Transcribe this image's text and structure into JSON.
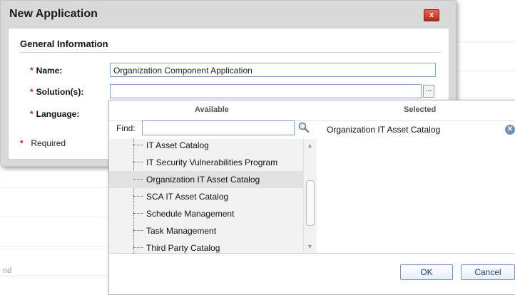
{
  "dialog": {
    "title": "New Application",
    "close_label": "x",
    "section_title": "General Information",
    "fields": {
      "name_label": "Name:",
      "name_value": "Organization Component Application",
      "solutions_label": "Solution(s):",
      "solutions_value": "",
      "solutions_button": "...",
      "language_label": "Language:"
    },
    "required_star": "*",
    "required_text": "Required"
  },
  "picker": {
    "available_header": "Available",
    "selected_header": "Selected",
    "find_label": "Find:",
    "find_value": "",
    "available_items": [
      "IT Asset Catalog",
      "IT Security Vulnerabilities Program",
      "Organization IT Asset Catalog",
      "SCA IT Asset Catalog",
      "Schedule Management",
      "Task Management",
      "Third Party Catalog"
    ],
    "highlighted_item": "Organization IT Asset Catalog",
    "selected_items": [
      "Organization IT Asset Catalog"
    ],
    "ok_label": "OK",
    "cancel_label": "Cancel",
    "icons": {
      "find": "search-icon",
      "remove": "remove-icon",
      "scroll_up": "scroll-up-arrow-icon",
      "scroll_down": "scroll-down-arrow-icon"
    }
  },
  "background": {
    "fragment_text": "nd"
  },
  "colors": {
    "required_star": "#d02020",
    "close_button": "#c9382a",
    "input_border": "#7fa6cf",
    "button_text": "#1b3f7a"
  }
}
